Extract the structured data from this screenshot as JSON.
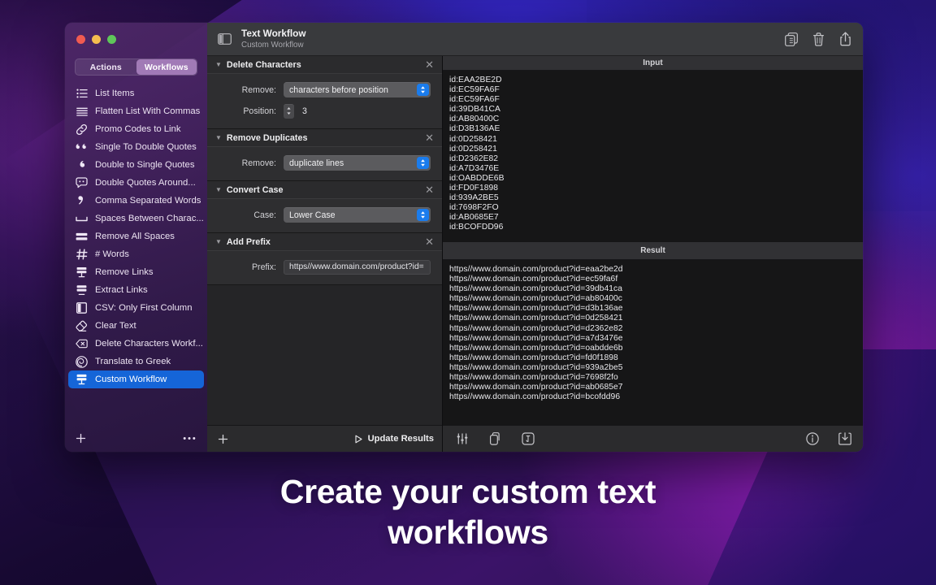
{
  "window": {
    "traffic_lights": [
      "close",
      "minimize",
      "zoom"
    ]
  },
  "sidebar": {
    "segmented": {
      "actions_label": "Actions",
      "workflows_label": "Workflows",
      "selected": "Workflows"
    },
    "items": [
      {
        "label": "List Items",
        "icon": "list-items-icon"
      },
      {
        "label": "Flatten List With Commas",
        "icon": "lines-icon"
      },
      {
        "label": "Promo Codes to Link",
        "icon": "link-icon"
      },
      {
        "label": "Single To Double Quotes",
        "icon": "double-quote-icon"
      },
      {
        "label": "Double to Single Quotes",
        "icon": "single-quote-icon"
      },
      {
        "label": "Double Quotes Around...",
        "icon": "quote-bubble-icon"
      },
      {
        "label": "Comma Separated Words",
        "icon": "comma-icon"
      },
      {
        "label": "Spaces Between Charac...",
        "icon": "space-bar-icon"
      },
      {
        "label": "Remove All Spaces",
        "icon": "two-bars-icon"
      },
      {
        "label": "# Words",
        "icon": "hash-icon"
      },
      {
        "label": "Remove Links",
        "icon": "remove-links-icon"
      },
      {
        "label": "Extract Links",
        "icon": "extract-links-icon"
      },
      {
        "label": "CSV: Only First Column",
        "icon": "column-icon"
      },
      {
        "label": "Clear Text",
        "icon": "eraser-icon"
      },
      {
        "label": "Delete Characters Workf...",
        "icon": "delete-back-icon"
      },
      {
        "label": "Translate to Greek",
        "icon": "spiral-icon"
      },
      {
        "label": "Custom Workflow",
        "icon": "workflow-icon",
        "selected": true
      }
    ],
    "footer": {
      "add_label": "+",
      "more_label": "•••"
    }
  },
  "titlebar": {
    "title": "Text Workflow",
    "subtitle": "Custom Workflow",
    "sidebar_toggle_icon": "sidebar-toggle-icon",
    "actions": [
      {
        "icon": "duplicate-icon",
        "name": "duplicate-button"
      },
      {
        "icon": "trash-icon",
        "name": "delete-button"
      },
      {
        "icon": "share-icon",
        "name": "share-button"
      }
    ]
  },
  "actions_panel": {
    "cards": [
      {
        "title": "Delete Characters",
        "fields": [
          {
            "type": "popup",
            "label": "Remove:",
            "value": "characters before position"
          },
          {
            "type": "stepper",
            "label": "Position:",
            "value": "3"
          }
        ]
      },
      {
        "title": "Remove Duplicates",
        "fields": [
          {
            "type": "popup",
            "label": "Remove:",
            "value": "duplicate lines"
          }
        ]
      },
      {
        "title": "Convert Case",
        "fields": [
          {
            "type": "popup",
            "label": "Case:",
            "value": "Lower Case"
          }
        ]
      },
      {
        "title": "Add Prefix",
        "fields": [
          {
            "type": "text",
            "label": "Prefix:",
            "value": "https//www.domain.com/product?id="
          }
        ]
      }
    ],
    "footer": {
      "add_label": "+",
      "update_results_label": "Update Results"
    }
  },
  "io_panel": {
    "input_header": "Input",
    "result_header": "Result",
    "input_lines": [
      "id:EAA2BE2D",
      "id:EC59FA6F",
      "id:EC59FA6F",
      "id:39DB41CA",
      "id:AB80400C",
      "id:D3B136AE",
      "id:0D258421",
      "id:0D258421",
      "id:D2362E82",
      "id:A7D3476E",
      "id:OABDDE6B",
      "id:FD0F1898",
      "id:939A2BE5",
      "id:7698F2FO",
      "id:AB0685E7",
      "id:BCOFDD96"
    ],
    "result_lines": [
      "https//www.domain.com/product?id=eaa2be2d",
      "https//www.domain.com/product?id=ec59fa6f",
      "https//www.domain.com/product?id=39db41ca",
      "https//www.domain.com/product?id=ab80400c",
      "https//www.domain.com/product?id=d3b136ae",
      "https//www.domain.com/product?id=0d258421",
      "https//www.domain.com/product?id=d2362e82",
      "https//www.domain.com/product?id=a7d3476e",
      "https//www.domain.com/product?id=oabdde6b",
      "https//www.domain.com/product?id=fd0f1898",
      "https//www.domain.com/product?id=939a2be5",
      "https//www.domain.com/product?id=7698f2fo",
      "https//www.domain.com/product?id=ab0685e7",
      "https//www.domain.com/product?id=bcofdd96"
    ],
    "footer": {
      "left_icons": [
        {
          "icon": "sliders-icon",
          "name": "settings-button"
        },
        {
          "icon": "copy-icon",
          "name": "copy-button"
        },
        {
          "icon": "text-box-icon",
          "name": "insert-button"
        }
      ],
      "right_icons": [
        {
          "icon": "info-icon",
          "name": "info-button"
        },
        {
          "icon": "export-icon",
          "name": "export-button"
        }
      ]
    }
  },
  "caption": {
    "line1": "Create your custom text",
    "line2": "workflows"
  },
  "colors": {
    "accent_blue": "#1565d8",
    "popup_blue": "#1a7ced",
    "sidebar_purple": "#4e2868",
    "panel_dark": "#252527",
    "io_dark": "#161617"
  }
}
